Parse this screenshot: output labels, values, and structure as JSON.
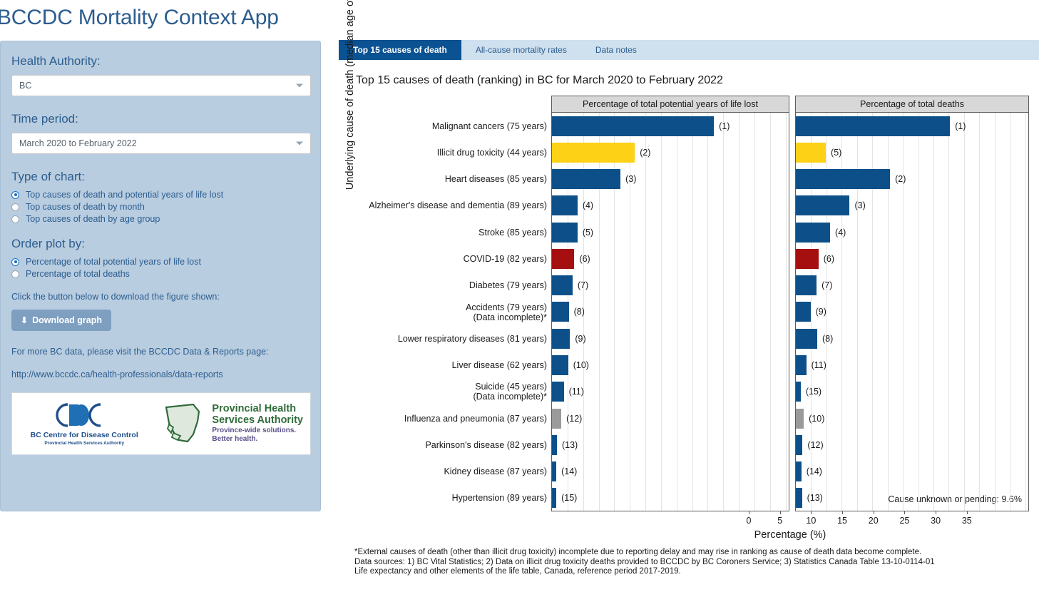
{
  "app": {
    "title": "BCCDC Mortality Context App"
  },
  "sidebar": {
    "health_authority_label": "Health Authority:",
    "health_authority_value": "BC",
    "time_period_label": "Time period:",
    "time_period_value": "March 2020 to February 2022",
    "chart_type_label": "Type of chart:",
    "chart_type_options": [
      {
        "label": "Top causes of death and potential years of life lost",
        "selected": true
      },
      {
        "label": "Top causes of death by month",
        "selected": false
      },
      {
        "label": "Top causes of death by age group",
        "selected": false
      }
    ],
    "order_by_label": "Order plot by:",
    "order_by_options": [
      {
        "label": "Percentage of total potential years of life lost",
        "selected": true
      },
      {
        "label": "Percentage of total deaths",
        "selected": false
      }
    ],
    "download_hint": "Click the button below to download the figure shown:",
    "download_button": "Download graph",
    "download_icon": "download-icon",
    "more_data_text": "For more BC data, please visit the BCCDC Data & Reports page:",
    "data_reports_url": "http://www.bccdc.ca/health-professionals/data-reports",
    "logos": {
      "bccdc_name": "BC Centre for Disease Control",
      "bccdc_sub": "Provincial Health Services Authority",
      "phsa_line1": "Provincial Health",
      "phsa_line2": "Services Authority",
      "phsa_tagline1": "Province-wide solutions.",
      "phsa_tagline2": "Better health."
    }
  },
  "tabs": [
    {
      "label": "Top 15 causes of death",
      "active": true
    },
    {
      "label": "All-cause mortality rates",
      "active": false
    },
    {
      "label": "Data notes",
      "active": false
    }
  ],
  "colors": {
    "blue": "#0D5089",
    "yellow": "#FCD116",
    "red": "#A50F0F",
    "gray": "#9A9A9A",
    "accent": "#0b5292",
    "sidebar_bg": "#b9cde0"
  },
  "chart_data": {
    "type": "bar",
    "title": "Top 15 causes of death (ranking) in BC for March 2020 to February 2022",
    "xlabel": "Percentage (%)",
    "ylabel": "Underlying cause of death (median age of death)",
    "xlim": [
      0,
      38
    ],
    "xticks": [
      0,
      5,
      10,
      15,
      20,
      25,
      30,
      35
    ],
    "grid": true,
    "legend": "none",
    "annotation": "Cause unknown or pending: 9.6%",
    "panels": [
      {
        "name": "pyll",
        "title": "Percentage of total potential years of life lost"
      },
      {
        "name": "deaths",
        "title": "Percentage of total deaths"
      }
    ],
    "categories": [
      "Malignant cancers (75 years)",
      "Illicit drug toxicity (44 years)",
      "Heart diseases (85 years)",
      "Alzheimer's disease and dementia (89 years)",
      "Stroke (85 years)",
      "COVID-19 (82 years)",
      "Diabetes (79 years)",
      "Accidents (79 years)\n(Data incomplete)*",
      "Lower respiratory diseases (81 years)",
      "Liver disease (62 years)",
      "Suicide (45 years)\n(Data incomplete)*",
      "Influenza and pneumonia (87 years)",
      "Parkinson's disease (82 years)",
      "Kidney disease (87 years)",
      "Hypertension (89 years)"
    ],
    "bar_colors": [
      "blue",
      "yellow",
      "blue",
      "blue",
      "blue",
      "red",
      "blue",
      "blue",
      "blue",
      "blue",
      "blue",
      "gray",
      "blue",
      "blue",
      "blue"
    ],
    "series": [
      {
        "name": "Percentage of total potential years of life lost",
        "values": [
          26.0,
          13.3,
          11.0,
          4.1,
          4.1,
          3.6,
          3.3,
          2.7,
          2.9,
          2.6,
          1.9,
          1.5,
          0.8,
          0.7,
          0.7
        ],
        "ranks": [
          1,
          2,
          3,
          4,
          5,
          6,
          7,
          8,
          9,
          10,
          11,
          12,
          13,
          14,
          15
        ]
      },
      {
        "name": "Percentage of total deaths",
        "values": [
          25.2,
          4.9,
          15.4,
          8.8,
          5.6,
          3.7,
          3.4,
          2.4,
          3.5,
          1.7,
          0.8,
          1.3,
          1.1,
          0.9,
          1.0
        ],
        "ranks": [
          1,
          5,
          2,
          3,
          4,
          6,
          7,
          9,
          8,
          11,
          15,
          10,
          12,
          14,
          13
        ]
      }
    ]
  },
  "footnotes": [
    "*External causes of death (other than illicit drug toxicity) incomplete due to reporting delay and may rise in ranking as cause of death data become complete.",
    "Data sources: 1) BC Vital Statistics; 2) Data on illicit drug toxicity deaths provided to BCCDC by BC Coroners Service; 3) Statistics Canada Table 13-10-0114-01",
    "Life expectancy and other elements of the life table, Canada, reference period 2017-2019."
  ]
}
